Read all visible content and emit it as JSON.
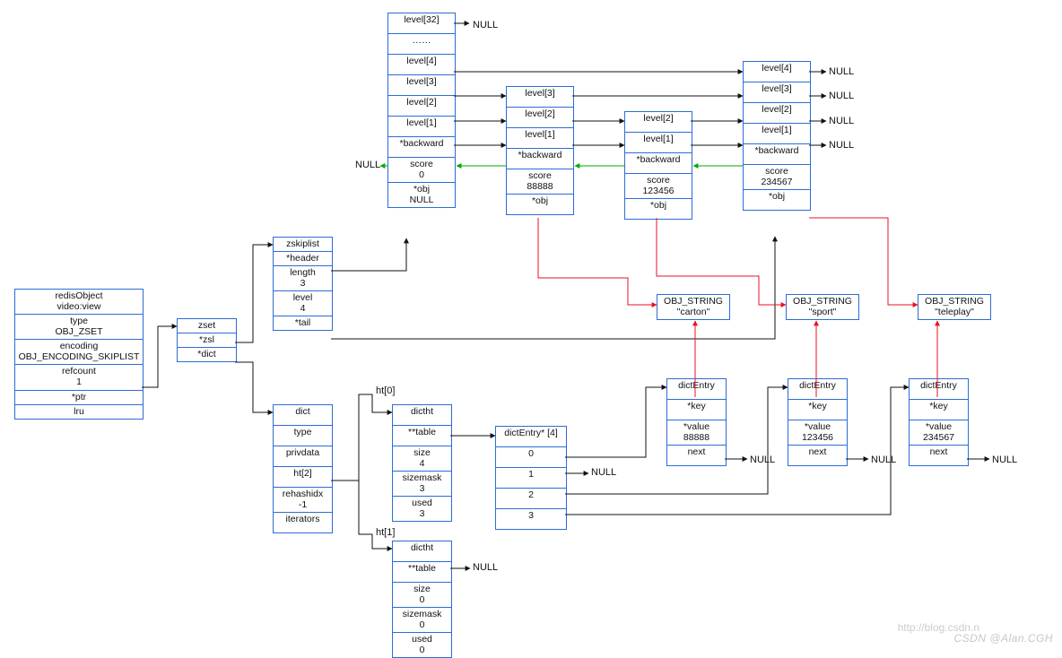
{
  "nullText": "NULL",
  "redisObject": {
    "title": "redisObject\nvideo:view",
    "type": "type\nOBJ_ZSET",
    "encoding": "encoding\nOBJ_ENCODING_SKIPLIST",
    "refcount": "refcount\n1",
    "ptr": "*ptr",
    "lru": "lru"
  },
  "zset": {
    "title": "zset",
    "zsl": "*zsl",
    "dict": "*dict"
  },
  "zskiplist": {
    "title": "zskiplist",
    "header": "*header",
    "length": "length\n3",
    "level": "level\n4",
    "tail": "*tail"
  },
  "headerNode": {
    "levels": [
      "level[32]",
      "……",
      "level[4]",
      "level[3]",
      "level[2]",
      "level[1]"
    ],
    "backward": "*backward",
    "score": "score\n0",
    "obj": "*obj\nNULL"
  },
  "node1": {
    "levels": [
      "level[3]",
      "level[2]",
      "level[1]"
    ],
    "backward": "*backward",
    "score": "score\n88888",
    "obj": "*obj"
  },
  "node2": {
    "levels": [
      "level[2]",
      "level[1]"
    ],
    "backward": "*backward",
    "score": "score\n123456",
    "obj": "*obj"
  },
  "node3": {
    "levels": [
      "level[4]",
      "level[3]",
      "level[2]",
      "level[1]"
    ],
    "backward": "*backward",
    "score": "score\n234567",
    "obj": "*obj"
  },
  "strings": {
    "s1": "OBJ_STRING\n\"carton\"",
    "s2": "OBJ_STRING\n\"sport\"",
    "s3": "OBJ_STRING\n\"teleplay\""
  },
  "dict": {
    "title": "dict",
    "type": "type",
    "privdata": "privdata",
    "ht": "ht[2]",
    "rehashidx": "rehashidx\n-1",
    "iterators": "iterators"
  },
  "htLabels": {
    "ht0": "ht[0]",
    "ht1": "ht[1]"
  },
  "dictht0": {
    "title": "dictht",
    "table": "**table",
    "size": "size\n4",
    "sizemask": "sizemask\n3",
    "used": "used\n3"
  },
  "dictht1": {
    "title": "dictht",
    "table": "**table",
    "size": "size\n0",
    "sizemask": "sizemask\n0",
    "used": "used\n0"
  },
  "dictEntryArr": {
    "title": "dictEntry* [4]",
    "0": "0",
    "1": "1",
    "2": "2",
    "3": "3"
  },
  "entries": {
    "e1": {
      "title": "dictEntry",
      "key": "*key",
      "value": "*value\n88888",
      "next": "next"
    },
    "e2": {
      "title": "dictEntry",
      "key": "*key",
      "value": "*value\n123456",
      "next": "next"
    },
    "e3": {
      "title": "dictEntry",
      "key": "*key",
      "value": "*value\n234567",
      "next": "next"
    }
  },
  "watermark": "CSDN @Alan.CGH",
  "blogurl": "http://blog.csdn.n"
}
